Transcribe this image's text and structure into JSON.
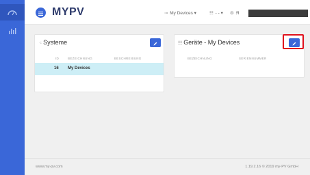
{
  "app": {
    "logo": "MYPV"
  },
  "sidebar": {
    "items": [
      {
        "icon": "dashboard-gauge-icon",
        "active": true
      },
      {
        "icon": "bar-chart-icon",
        "active": false
      }
    ]
  },
  "topbar": {
    "devices_menu": {
      "icon": "link-icon",
      "label": "My Devices",
      "caret": "▾"
    },
    "list_menu": {
      "icon": "list-icon",
      "label": "- -",
      "caret": "▾"
    },
    "user_menu": {
      "icon": "settings-icon",
      "label": "Я"
    }
  },
  "systems_card": {
    "title": "Systeme",
    "columns": [
      "ID",
      "BEZEICHNUNG",
      "BESCHREIBUNG"
    ],
    "rows": [
      {
        "id": "16",
        "name": "My Devices",
        "description": ""
      }
    ]
  },
  "devices_card": {
    "title": "Geräte - My Devices",
    "columns": [
      "BEZEICHNUNG",
      "SERIENNUMMER"
    ]
  },
  "footer": {
    "website": "www.my-pv.com",
    "version": "1.19.2.16 © 2019 my-PV GmbH"
  },
  "colors": {
    "accent": "#3a67d8",
    "highlight": "#e0101b",
    "selected_row": "#cdeef6"
  }
}
